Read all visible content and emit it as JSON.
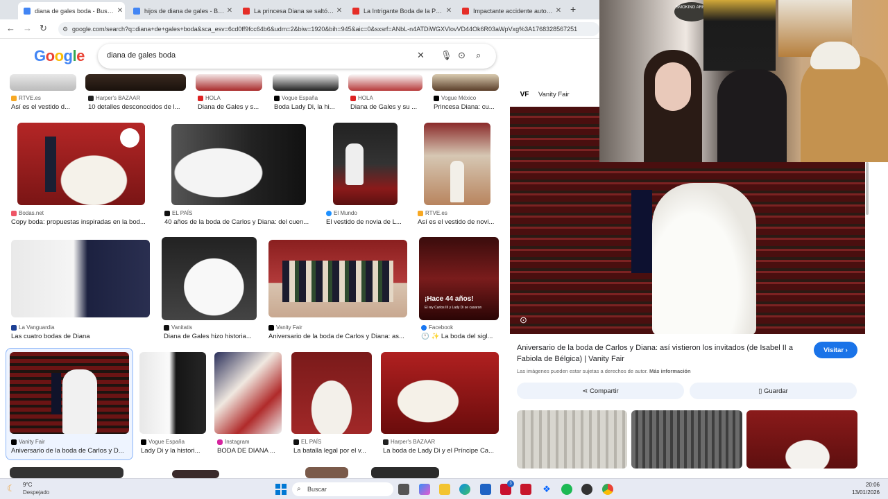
{
  "browser": {
    "tabs": [
      {
        "label": "diana de gales boda - Buscar c",
        "favicon_color": "#4285f4",
        "active": true
      },
      {
        "label": "hijos de diana de gales - Busca",
        "favicon_color": "#4285f4",
        "active": false
      },
      {
        "label": "La princesa Diana se saltó el pr",
        "favicon_color": "#e52d27",
        "active": false
      },
      {
        "label": "La Intrigante Boda de la Prince",
        "favicon_color": "#e52d27",
        "active": false
      },
      {
        "label": "Impactante accidente automov",
        "favicon_color": "#e52d27",
        "active": false
      }
    ],
    "new_tab": "+",
    "url": "google.com/search?q=diana+de+gales+boda&sca_esv=6cd0ff9fcc64b6&udm=2&biw=1920&bih=945&aic=0&sxsrf=ANbL-n4ATDiWGXVlovVD44Ok6R03aWpVxg%3A1768328567251"
  },
  "google": {
    "logo": "Google",
    "query": "diana de gales boda"
  },
  "grid": {
    "row0": [
      {
        "source": "RTVE.es",
        "caption": "Así es el vestido d..."
      },
      {
        "source": "Harper's BAZAAR",
        "caption": "10 detalles desconocidos de l..."
      },
      {
        "source": "HOLA",
        "caption": "Diana de Gales y s..."
      },
      {
        "source": "Vogue España",
        "caption": "Boda Lady Di, la hi..."
      },
      {
        "source": "HOLA",
        "caption": "Diana de Gales y su ..."
      },
      {
        "source": "Vogue México",
        "caption": "Princesa Diana: cu..."
      }
    ],
    "row1": [
      {
        "source": "Bodas.net",
        "caption": "Copy boda: propuestas inspiradas en la bod..."
      },
      {
        "source": "EL PAÍS",
        "caption": "40 años de la boda de Carlos y Diana: del cuen..."
      },
      {
        "source": "El Mundo",
        "caption": "El vestido de novia de L..."
      },
      {
        "source": "RTVE.es",
        "caption": "Así es el vestido de novi..."
      }
    ],
    "row2": [
      {
        "source": "La Vanguardia",
        "caption": "Las cuatro bodas de Diana"
      },
      {
        "source": "Vanitatis",
        "caption": "Diana de Gales hizo historia..."
      },
      {
        "source": "Vanity Fair",
        "caption": "Aniversario de la boda de Carlos y Diana: as..."
      },
      {
        "source": "Facebook",
        "caption": "🕛 ✨ La boda del sigl..."
      }
    ],
    "row2_overlay": "¡Hace 44 años!",
    "row2_overlay_sub": "El rey Carlos III y Lady Di se casaron",
    "row3": [
      {
        "source": "Vanity Fair",
        "caption": "Aniversario de la boda de Carlos y D..."
      },
      {
        "source": "Vogue España",
        "caption": "Lady Di y la histori..."
      },
      {
        "source": "Instagram",
        "caption": "BODA DE DIANA ..."
      },
      {
        "source": "EL PAÍS",
        "caption": "La batalla legal por el v..."
      },
      {
        "source": "Harper's BAZAAR",
        "caption": "La boda de Lady Di y el Príncipe Ca..."
      }
    ]
  },
  "panel": {
    "source": "Vanity Fair",
    "source_badge": "VF",
    "title": "Aniversario de la boda de Carlos y Diana: así vistieron los invitados (de Isabel II a Fabiola de Bélgica) | Vanity Fair",
    "visit_label": "Visitar",
    "copyright_note": "Las imágenes pueden estar sujetas a derechos de autor.",
    "more_info": "Más información",
    "share_label": "Compartir",
    "save_label": "Guardar"
  },
  "webcam": {
    "sign": "SMOKING AREA"
  },
  "taskbar": {
    "weather_temp": "9°C",
    "weather_desc": "Despejado",
    "search_placeholder": "Buscar",
    "time": "20:06",
    "date": "13/01/2026",
    "badge_count": "3"
  }
}
